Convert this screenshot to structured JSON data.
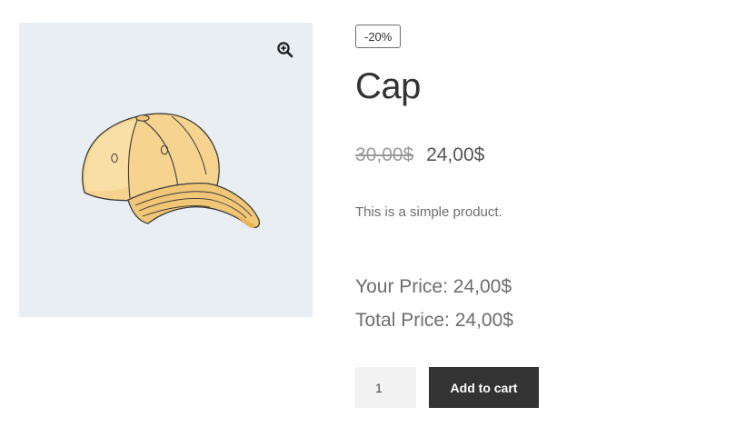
{
  "gallery": {
    "zoom_icon": "magnifier-plus-icon",
    "image_subject": "cap-image"
  },
  "product": {
    "sale_badge": "-20%",
    "title": "Cap",
    "regular_price": "30,00$",
    "sale_price": "24,00$",
    "short_description": "This is a simple product.",
    "your_price": "Your Price: 24,00$",
    "total_price": "Total Price: 24,00$"
  },
  "cart": {
    "quantity": "1",
    "add_to_cart_label": "Add to cart"
  },
  "colors": {
    "gallery_bg": "#e9eef3",
    "button_bg": "#333333",
    "button_text": "#ffffff",
    "text": "#6d6d6d",
    "heading": "#333333",
    "cap_fill": "#f6d38f"
  }
}
